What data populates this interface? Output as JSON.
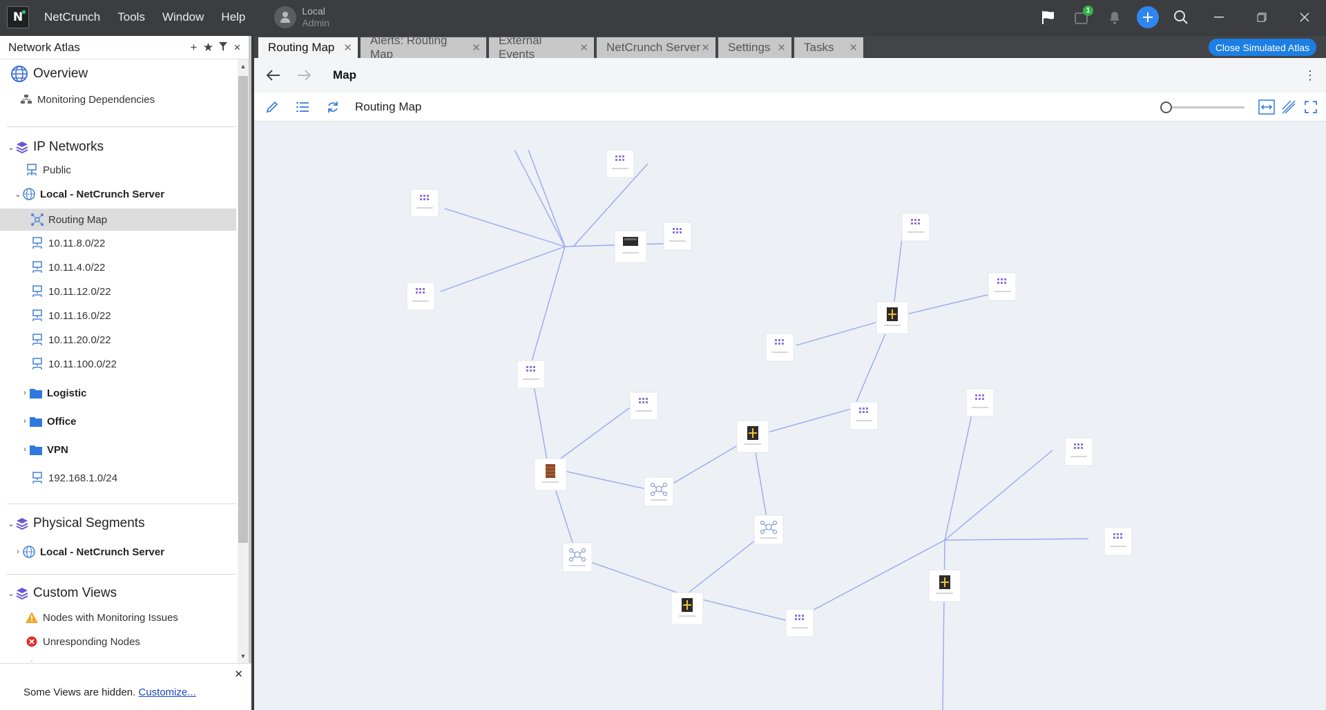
{
  "app": {
    "logo_text": "N",
    "menu": [
      "NetCrunch",
      "Tools",
      "Window",
      "Help"
    ]
  },
  "user": {
    "line1": "Local",
    "line2": "Admin"
  },
  "header": {
    "notification_count": "1"
  },
  "sidebar": {
    "title": "Network Atlas",
    "overview": "Overview",
    "monitoring_dependencies": "Monitoring Dependencies",
    "ip_networks": "IP Networks",
    "public": "Public",
    "local_server": "Local - NetCrunch Server",
    "routing_map": "Routing Map",
    "subnets": [
      "10.11.8.0/22",
      "10.11.4.0/22",
      "10.11.12.0/22",
      "10.11.16.0/22",
      "10.11.20.0/22",
      "10.11.100.0/22"
    ],
    "folders": [
      "Logistic",
      "Office",
      "VPN"
    ],
    "lan": "192.168.1.0/24",
    "physical_segments": "Physical Segments",
    "phys_local_server": "Local - NetCrunch Server",
    "custom_views": "Custom Views",
    "views": [
      "Nodes with Monitoring Issues",
      "Unresponding Nodes"
    ],
    "hidden_note": "Some Views are hidden.",
    "customize_link": "Customize..."
  },
  "tabs": [
    "Routing Map",
    "Alerts: Routing Map",
    "External Events",
    "NetCrunch Server",
    "Settings",
    "Tasks"
  ],
  "close_simulated": "Close Simulated Atlas",
  "nav": {
    "title": "Map"
  },
  "toolbar": {
    "map_name": "Routing Map"
  },
  "colors": {
    "link": "#9aa8ee",
    "accent": "#1c7fe3",
    "node_icon": "#8f74d8"
  },
  "map_icons": [
    "router-icon",
    "firewall-icon",
    "switch-icon",
    "network-icon",
    "server-icon"
  ]
}
